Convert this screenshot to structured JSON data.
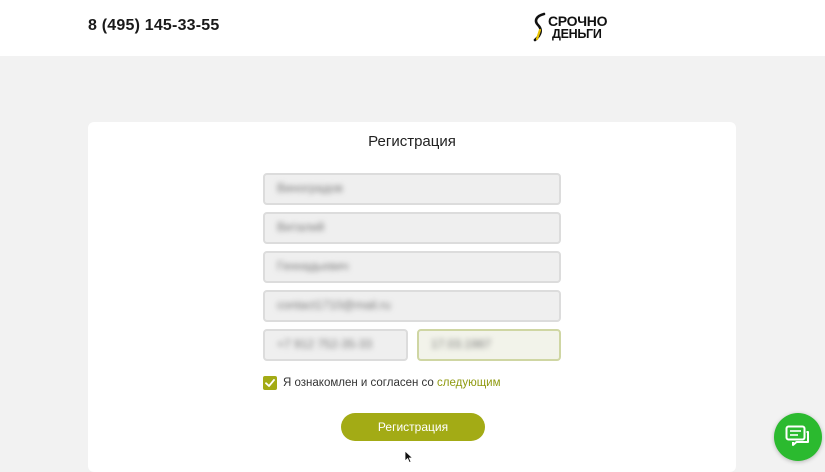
{
  "header": {
    "phone": "8 (495) 145-33-55",
    "logo_top": "СРОЧНО",
    "logo_bottom": "ДЕНЬГИ"
  },
  "form": {
    "title": "Регистрация",
    "fields": [
      {
        "name": "surname",
        "value": "Виноградов"
      },
      {
        "name": "first-name",
        "value": "Виталий"
      },
      {
        "name": "patronymic",
        "value": "Геннадьевич"
      },
      {
        "name": "email",
        "value": "contact1710@mail.ru"
      },
      {
        "name": "phone",
        "value": "+7 912 752-35-33"
      },
      {
        "name": "birth-date",
        "value": "17.03.1987"
      }
    ],
    "agree_text": "Я ознакомлен и согласен со ",
    "agree_link": "следующим",
    "agree_checked": true,
    "submit_label": "Регистрация"
  },
  "colors": {
    "accent": "#a3ab15",
    "chat": "#2bba2f"
  },
  "icons": {
    "logo": "logo-mark-icon",
    "check": "check-icon",
    "chat": "chat-icon",
    "cursor": "mouse-cursor-icon"
  }
}
